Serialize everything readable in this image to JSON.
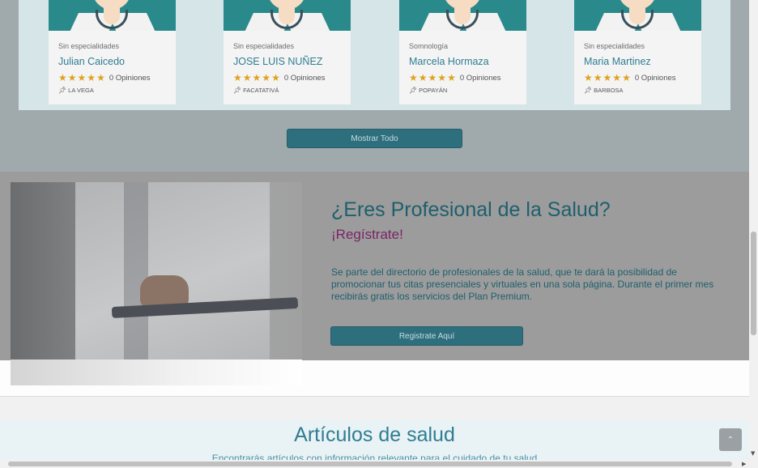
{
  "doctors": [
    {
      "specialty": "Sin especialidades",
      "name": "Julian Caicedo",
      "opinions": "0 Opiniones",
      "city": "LA VEGA"
    },
    {
      "specialty": "Sin especialidades",
      "name": "JOSE LUIS NUÑEZ",
      "opinions": "0 Opiniones",
      "city": "FACATATIVÁ"
    },
    {
      "specialty": "Somnología",
      "name": "Marcela Hormaza",
      "opinions": "0 Opiniones",
      "city": "POPAYÁN"
    },
    {
      "specialty": "Sin especialidades",
      "name": "Maria Martinez",
      "opinions": "0 Opiniones",
      "city": "BARBOSA"
    }
  ],
  "rating_stars": 5,
  "star_glyph": "★",
  "pin_glyph": "📌",
  "show_all_label": "Mostrar Todo",
  "professional": {
    "title": "¿Eres Profesional de la Salud?",
    "subtitle": "¡Regístrate!",
    "description": "Se parte del directorio de profesionales de la salud, que te dará la posibilidad de promocionar tus citas presenciales y virtuales en una sola página. Durante el primer mes recibirás gratis los servicios del Plan Premium.",
    "register_label": "Registrate Aquí"
  },
  "articles": {
    "title": "Artículos de salud",
    "subtitle": "Encontrarás artículos con información relevante para el cuidado de tu salud"
  },
  "scroll_top_icon": "⌃",
  "colors": {
    "accent": "#2e6f7e",
    "link": "#2f7d92",
    "highlight": "#7a2466",
    "star": "#e0a21c"
  }
}
